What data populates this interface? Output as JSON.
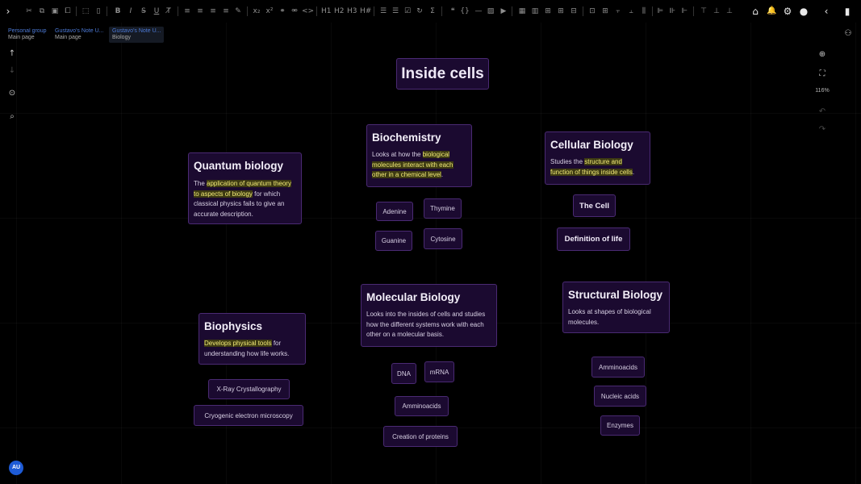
{
  "toolbar": {
    "icons": [
      {
        "id": "expand",
        "icon": "chevron-right-icon",
        "glyph": "›"
      },
      {
        "id": "cut",
        "icon": "cut-icon",
        "glyph": "✂"
      },
      {
        "id": "copy",
        "icon": "copy-icon",
        "glyph": "⧉"
      },
      {
        "id": "paste",
        "icon": "paste-icon",
        "glyph": "▣"
      },
      {
        "id": "duplicate",
        "icon": "duplicate-icon",
        "glyph": "⧠"
      },
      {
        "id": "select-all",
        "icon": "select-all-icon",
        "glyph": "⬚"
      },
      {
        "id": "delete",
        "icon": "trash-icon",
        "glyph": "▯"
      },
      {
        "id": "bold",
        "icon": "bold-icon",
        "glyph": "B"
      },
      {
        "id": "italic",
        "icon": "italic-icon",
        "glyph": "I"
      },
      {
        "id": "strike",
        "icon": "strikethrough-icon",
        "glyph": "S̶"
      },
      {
        "id": "underline",
        "icon": "underline-icon",
        "glyph": "U"
      },
      {
        "id": "clear-format",
        "icon": "clear-format-icon",
        "glyph": "T̸"
      },
      {
        "id": "align-left",
        "icon": "align-left-icon",
        "glyph": "≡"
      },
      {
        "id": "align-center",
        "icon": "align-center-icon",
        "glyph": "≡"
      },
      {
        "id": "align-right",
        "icon": "align-right-icon",
        "glyph": "≡"
      },
      {
        "id": "align-justify",
        "icon": "align-justify-icon",
        "glyph": "≡"
      },
      {
        "id": "highlight",
        "icon": "highlighter-icon",
        "glyph": "✎"
      },
      {
        "id": "subscript",
        "icon": "subscript-icon",
        "glyph": "x₂"
      },
      {
        "id": "superscript",
        "icon": "superscript-icon",
        "glyph": "x²"
      },
      {
        "id": "link",
        "icon": "link-icon",
        "glyph": "⚭"
      },
      {
        "id": "unlink",
        "icon": "unlink-icon",
        "glyph": "⚮"
      },
      {
        "id": "code",
        "icon": "code-icon",
        "glyph": "<>"
      },
      {
        "id": "h1",
        "icon": "heading-1-icon",
        "glyph": "H1"
      },
      {
        "id": "h2",
        "icon": "heading-2-icon",
        "glyph": "H2"
      },
      {
        "id": "h3",
        "icon": "heading-3-icon",
        "glyph": "H3"
      },
      {
        "id": "hh",
        "icon": "heading-hash-icon",
        "glyph": "H#"
      },
      {
        "id": "ul",
        "icon": "bullet-list-icon",
        "glyph": "☰"
      },
      {
        "id": "ol",
        "icon": "numbered-list-icon",
        "glyph": "☰"
      },
      {
        "id": "check",
        "icon": "checklist-icon",
        "glyph": "☑"
      },
      {
        "id": "spin",
        "icon": "rotate-icon",
        "glyph": "↻"
      },
      {
        "id": "sigma",
        "icon": "sigma-icon",
        "glyph": "Σ"
      },
      {
        "id": "quote",
        "icon": "quote-icon",
        "glyph": "❝"
      },
      {
        "id": "braces",
        "icon": "braces-icon",
        "glyph": "{}"
      },
      {
        "id": "hr",
        "icon": "horizontal-rule-icon",
        "glyph": "—"
      },
      {
        "id": "image",
        "icon": "image-icon",
        "glyph": "▨"
      },
      {
        "id": "video",
        "icon": "video-icon",
        "glyph": "▶"
      },
      {
        "id": "table",
        "icon": "table-icon",
        "glyph": "▦"
      },
      {
        "id": "col-before",
        "icon": "insert-column-icon",
        "glyph": "▥"
      },
      {
        "id": "col-after",
        "icon": "add-column-icon",
        "glyph": "⊞"
      },
      {
        "id": "col-del",
        "icon": "delete-column-icon",
        "glyph": "⊟"
      },
      {
        "id": "merge",
        "icon": "merge-icon",
        "glyph": "⊡"
      },
      {
        "id": "split",
        "icon": "split-icon",
        "glyph": "⊞"
      },
      {
        "id": "align-vc",
        "icon": "align-vertical-center-icon",
        "glyph": "⫟"
      },
      {
        "id": "align-b",
        "icon": "align-bottom-icon",
        "glyph": "⫠"
      },
      {
        "id": "dist",
        "icon": "distribute-icon",
        "glyph": "⫼"
      },
      {
        "id": "al-left",
        "icon": "align-objects-left-icon",
        "glyph": "⊫"
      },
      {
        "id": "al-hc",
        "icon": "align-objects-center-icon",
        "glyph": "⊪"
      },
      {
        "id": "al-right",
        "icon": "align-objects-right-icon",
        "glyph": "⊩"
      },
      {
        "id": "al-top",
        "icon": "align-objects-top-icon",
        "glyph": "⊤"
      },
      {
        "id": "al-mid",
        "icon": "align-objects-middle-icon",
        "glyph": "⊥"
      },
      {
        "id": "al-bottom",
        "icon": "align-objects-bottom-icon",
        "glyph": "⊥"
      },
      {
        "id": "chart",
        "icon": "bar-chart-icon",
        "glyph": "▮"
      }
    ],
    "right_icons": [
      {
        "id": "home",
        "icon": "home-icon",
        "glyph": "⌂"
      },
      {
        "id": "bell",
        "icon": "bell-icon",
        "glyph": "🔔"
      },
      {
        "id": "settings",
        "icon": "gear-icon",
        "glyph": "⚙"
      },
      {
        "id": "user",
        "icon": "user-icon",
        "glyph": "●"
      },
      {
        "id": "collapse",
        "icon": "chevron-left-icon",
        "glyph": "‹"
      },
      {
        "id": "panel",
        "icon": "panel-icon",
        "glyph": "▥"
      }
    ]
  },
  "breadcrumbs": [
    {
      "top": "Personal group",
      "bottom": "Main page"
    },
    {
      "top": "Gustavo's Note U...",
      "bottom": "Main page"
    },
    {
      "top": "Gustavo's Note U...",
      "bottom": "Biology"
    }
  ],
  "left_controls": [
    {
      "icon": "arrow-up-icon",
      "glyph": "↑"
    },
    {
      "icon": "arrow-down-icon",
      "glyph": "↓"
    },
    {
      "icon": "camera-icon",
      "glyph": "⊙"
    },
    {
      "icon": "search-zoom-icon",
      "glyph": "⌕"
    }
  ],
  "right_controls": {
    "zoom_in_glyph": "⊕",
    "fit_glyph": "⛶",
    "zoom_level": "116%",
    "undo_glyph": "↶",
    "redo_glyph": "↷",
    "user_settings_glyph": "⚇"
  },
  "canvas": {
    "title": "Inside cells",
    "biochemistry": {
      "title": "Biochemistry",
      "desc_pre": "Looks at how the ",
      "desc_hl": "biological molecules interact with each other in a chemical level",
      "desc_post": ".",
      "children": [
        "Adenine",
        "Thymine",
        "Guanine",
        "Cytosine"
      ]
    },
    "quantum": {
      "title": "Quantum biology",
      "desc_pre": "The ",
      "desc_hl": "application of quantum theory to aspects of biology",
      "desc_post": " for which classical physics fails to give an accurate description."
    },
    "cellular": {
      "title": "Cellular Biology",
      "desc_pre": "Studies the ",
      "desc_hl": "structure and function of things inside cells",
      "desc_post": ".",
      "children": [
        "The Cell",
        "Definition of life"
      ]
    },
    "biophysics": {
      "title": "Biophysics",
      "desc_hl": "Develops physical tools",
      "desc_post": " for understanding how life works.",
      "children": [
        "X-Ray Crystallography",
        "Cryogenic electron microscopy"
      ]
    },
    "molecular": {
      "title": "Molecular Biology",
      "desc": "Looks into the insides of cells and studies how the different systems work with each other on a molecular basis.",
      "children": [
        "DNA",
        "mRNA",
        "Amminoacids",
        "Creation of proteins"
      ]
    },
    "structural": {
      "title": "Structural Biology",
      "desc": "Looks at shapes of biological molecules.",
      "children": [
        "Amminoacids",
        "Nucleic acids",
        "Enzymes"
      ]
    }
  },
  "avatar": "AU"
}
